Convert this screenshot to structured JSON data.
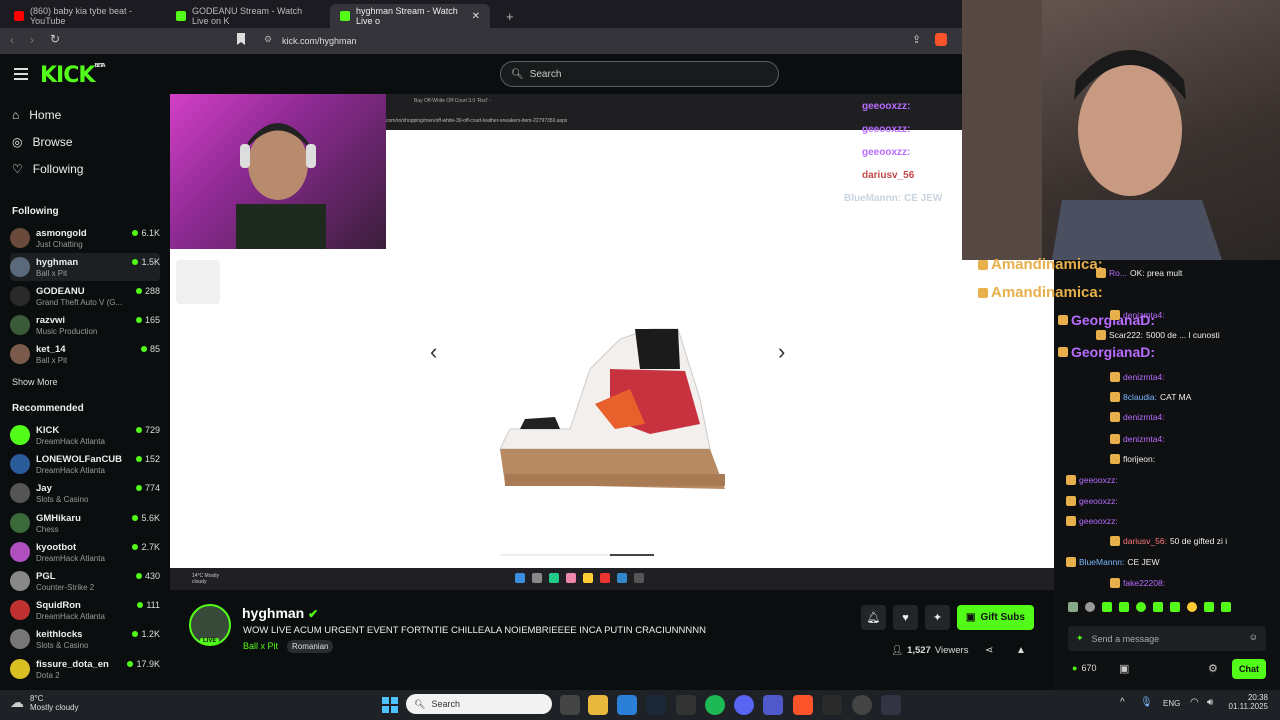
{
  "browser": {
    "tabs": [
      {
        "label": "(860) baby kia tybe beat - YouTube",
        "color": "#ff0000"
      },
      {
        "label": "GODEANU Stream - Watch Live on K",
        "color": "#53fc18"
      },
      {
        "label": "hyghman Stream - Watch Live o",
        "color": "#53fc18"
      }
    ],
    "url": "kick.com/hyghman"
  },
  "kick": {
    "logo": "KICK",
    "logo_sup": "BETA",
    "search_placeholder": "Search"
  },
  "sidebar": {
    "nav": [
      {
        "label": "Home",
        "icon": "home-icon"
      },
      {
        "label": "Browse",
        "icon": "compass-icon"
      },
      {
        "label": "Following",
        "icon": "heart-icon"
      }
    ],
    "following_title": "Following",
    "following": [
      {
        "name": "asmongold",
        "category": "Just Chatting",
        "viewers": "6.1K"
      },
      {
        "name": "hyghman",
        "category": "Ball x Pit",
        "viewers": "1.5K"
      },
      {
        "name": "GODEANU",
        "category": "Grand Theft Auto V (G...",
        "viewers": "288"
      },
      {
        "name": "razvwi",
        "category": "Music Production",
        "viewers": "165"
      },
      {
        "name": "ket_14",
        "category": "Ball x Pit",
        "viewers": "85"
      }
    ],
    "show_more": "Show More",
    "recommended_title": "Recommended",
    "recommended": [
      {
        "name": "KICK",
        "category": "DreamHack Atlanta",
        "viewers": "729"
      },
      {
        "name": "LONEWOLFanCUB",
        "category": "DreamHack Atlanta",
        "viewers": "152"
      },
      {
        "name": "Jay",
        "category": "Slots & Casino",
        "viewers": "774"
      },
      {
        "name": "GMHikaru",
        "category": "Chess",
        "viewers": "5.6K"
      },
      {
        "name": "kyootbot",
        "category": "DreamHack Atlanta",
        "viewers": "2.7K"
      },
      {
        "name": "PGL",
        "category": "Counter-Strike 2",
        "viewers": "430"
      },
      {
        "name": "SquidRon",
        "category": "DreamHack Atlanta",
        "viewers": "111"
      },
      {
        "name": "keithlocks",
        "category": "Slots & Casino",
        "viewers": "1.2K"
      },
      {
        "name": "fissure_dota_en",
        "category": "Dota 2",
        "viewers": "17.9K"
      }
    ]
  },
  "video": {
    "inner_tab": "Buy Off-White Off-Court 3.0 'Red' -",
    "inner_url": "com/ro/shopping/men/off-white-30-off-court-leather-sneakers-item-22797350.aspx",
    "weather": "14°C Mostly cloudy",
    "overlay_chat": [
      {
        "user": "geeooxzz:"
      },
      {
        "user": "geeooxzz:"
      },
      {
        "user": "geeooxzz:"
      },
      {
        "user": "dariusv_56"
      },
      {
        "user": "BlueMannn:",
        "text": "CE JEW"
      }
    ]
  },
  "chat": {
    "messages": [
      {
        "user": "Amandinamica:",
        "text": "",
        "color": "#e8b04a"
      },
      {
        "user": "Amandinamica:",
        "text": "",
        "color": "#e8b04a"
      },
      {
        "user": "GeorgianaD:",
        "text": "",
        "color": "#b96cff"
      },
      {
        "user": "GeorgianaD:",
        "text": "",
        "color": "#b96cff"
      },
      {
        "user": "Ro...",
        "text": "OK: prea mult",
        "color": "#b96cff"
      },
      {
        "user": "denizmta4:",
        "text": "",
        "color": "#b96cff"
      },
      {
        "user": "Scar222:",
        "text": "5000 de ... l cunosti",
        "color": "#eee"
      },
      {
        "user": "denizmta4:",
        "text": "",
        "color": "#b96cff"
      },
      {
        "user": "8claudia:",
        "text": "CAT MA",
        "color": "#7ab7ff"
      },
      {
        "user": "denizmta4:",
        "text": "",
        "color": "#b96cff"
      },
      {
        "user": "denizmta4:",
        "text": "",
        "color": "#b96cff"
      },
      {
        "user": "florijeon:",
        "text": "",
        "color": "#eee"
      },
      {
        "user": "geeooxzz:",
        "text": "",
        "color": "#b96cff"
      },
      {
        "user": "geeooxzz:",
        "text": "",
        "color": "#b96cff"
      },
      {
        "user": "geeooxzz:",
        "text": "",
        "color": "#b96cff"
      },
      {
        "user": "dariusv_56:",
        "text": "50 de gifted zi i",
        "color": "#ff7a7a"
      },
      {
        "user": "BlueMannn:",
        "text": "CE JEW",
        "color": "#7ab7ff"
      },
      {
        "user": "fake22208:",
        "text": "",
        "color": "#b96cff"
      }
    ],
    "input_placeholder": "Send a message",
    "points": "670",
    "chat_button": "Chat"
  },
  "stream": {
    "streamer": "hyghman",
    "title": "WOW LIVE ACUM URGENT EVENT FORTNTIE CHILLEALA NOIEMBRIEEEE INCA PUTIN CRACIUNNNNN",
    "category": "Ball x Pit",
    "language": "Romanian",
    "viewers": "1,527",
    "viewers_label": "Viewers",
    "gift_label": "Gift Subs",
    "live_badge": "LIVE"
  },
  "os": {
    "weather_temp": "8°C",
    "weather_desc": "Mostly cloudy",
    "search_placeholder": "Search",
    "lang": "ENG",
    "time": "20:38",
    "date": "01.11.2025"
  },
  "colors": {
    "accent": "#53fc18",
    "bg": "#0b0e0f"
  }
}
